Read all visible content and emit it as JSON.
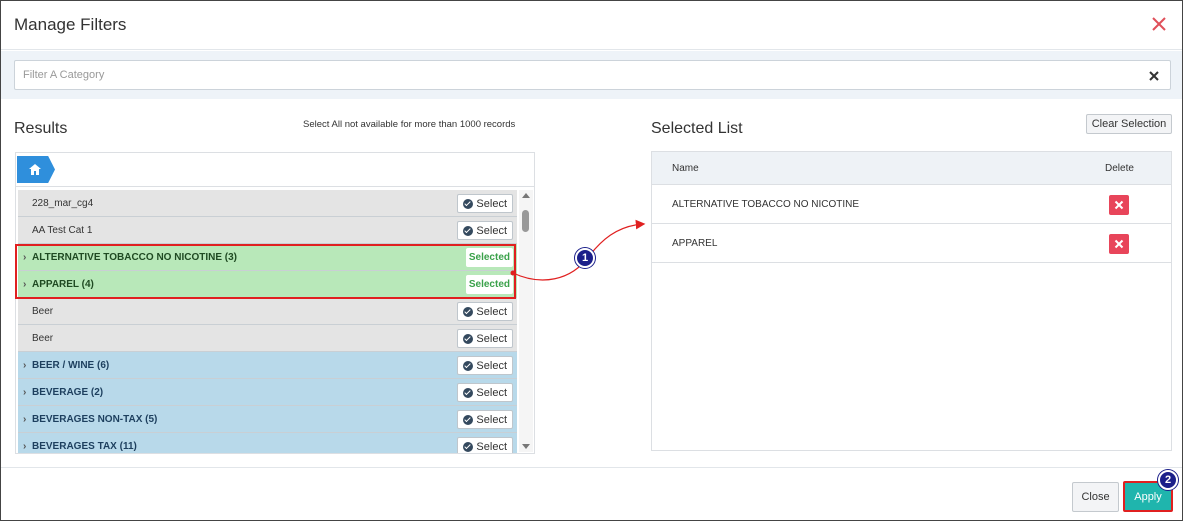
{
  "modal": {
    "title": "Manage Filters"
  },
  "filter": {
    "placeholder": "Filter A Category"
  },
  "results": {
    "title": "Results",
    "note": "Select All not available for more than 1000 records",
    "rows": [
      {
        "name": "228_mar_cg4",
        "kind": "plain",
        "action": "Select"
      },
      {
        "name": "AA Test Cat 1",
        "kind": "plain",
        "action": "Select"
      },
      {
        "name": "ALTERNATIVE TOBACCO NO NICOTINE (3)",
        "kind": "selected",
        "action": "Selected"
      },
      {
        "name": "APPAREL (4)",
        "kind": "selected",
        "action": "Selected"
      },
      {
        "name": "Beer",
        "kind": "plain",
        "action": "Select"
      },
      {
        "name": "Beer",
        "kind": "plain",
        "action": "Select"
      },
      {
        "name": "BEER / WINE (6)",
        "kind": "group",
        "action": "Select"
      },
      {
        "name": "BEVERAGE (2)",
        "kind": "group",
        "action": "Select"
      },
      {
        "name": "BEVERAGES NON-TAX (5)",
        "kind": "group",
        "action": "Select"
      },
      {
        "name": "BEVERAGES TAX (11)",
        "kind": "group",
        "action": "Select"
      }
    ]
  },
  "selected_list": {
    "title": "Selected List",
    "clear_label": "Clear Selection",
    "col_name": "Name",
    "col_delete": "Delete",
    "items": [
      "ALTERNATIVE TOBACCO NO NICOTINE",
      "APPAREL"
    ]
  },
  "annotations": {
    "step1": "1",
    "step2": "2"
  },
  "footer": {
    "close_label": "Close",
    "apply_label": "Apply"
  },
  "icons": {
    "close": "close-icon",
    "clear_filter": "x-icon",
    "home": "home-icon",
    "check": "check-circle-icon",
    "chevron": "chevron-right-icon",
    "delete": "delete-x-icon"
  },
  "colors": {
    "selected_row": "#b8e8b9",
    "group_row": "#b8d9ea",
    "plain_row": "#e4e4e4",
    "apply": "#1fb5ad",
    "delete": "#e8455a",
    "home_crumb": "#2f8fdc",
    "annotation": "#e02020"
  }
}
